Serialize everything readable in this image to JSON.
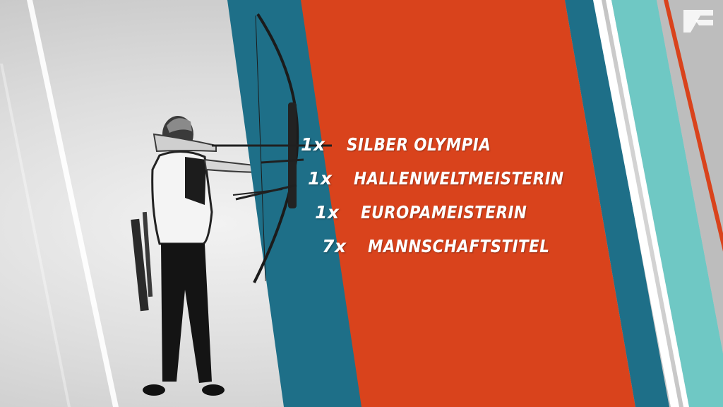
{
  "colors": {
    "orange": "#d9431c",
    "teal": "#1e6f88",
    "aqua": "#6fc8c4",
    "white": "#ffffff",
    "background": "#d8d8d8"
  },
  "achievements": [
    {
      "count": "1x",
      "title": "SILBER OLYMPIA"
    },
    {
      "count": "1x",
      "title": "HALLENWELTMEISTERIN"
    },
    {
      "count": "1x",
      "title": "EUROPAMEISTERIN"
    },
    {
      "count": "7x",
      "title": "MANNSCHAFTSTITEL"
    }
  ],
  "logo": {
    "icon": "prosieben-logo-icon"
  }
}
